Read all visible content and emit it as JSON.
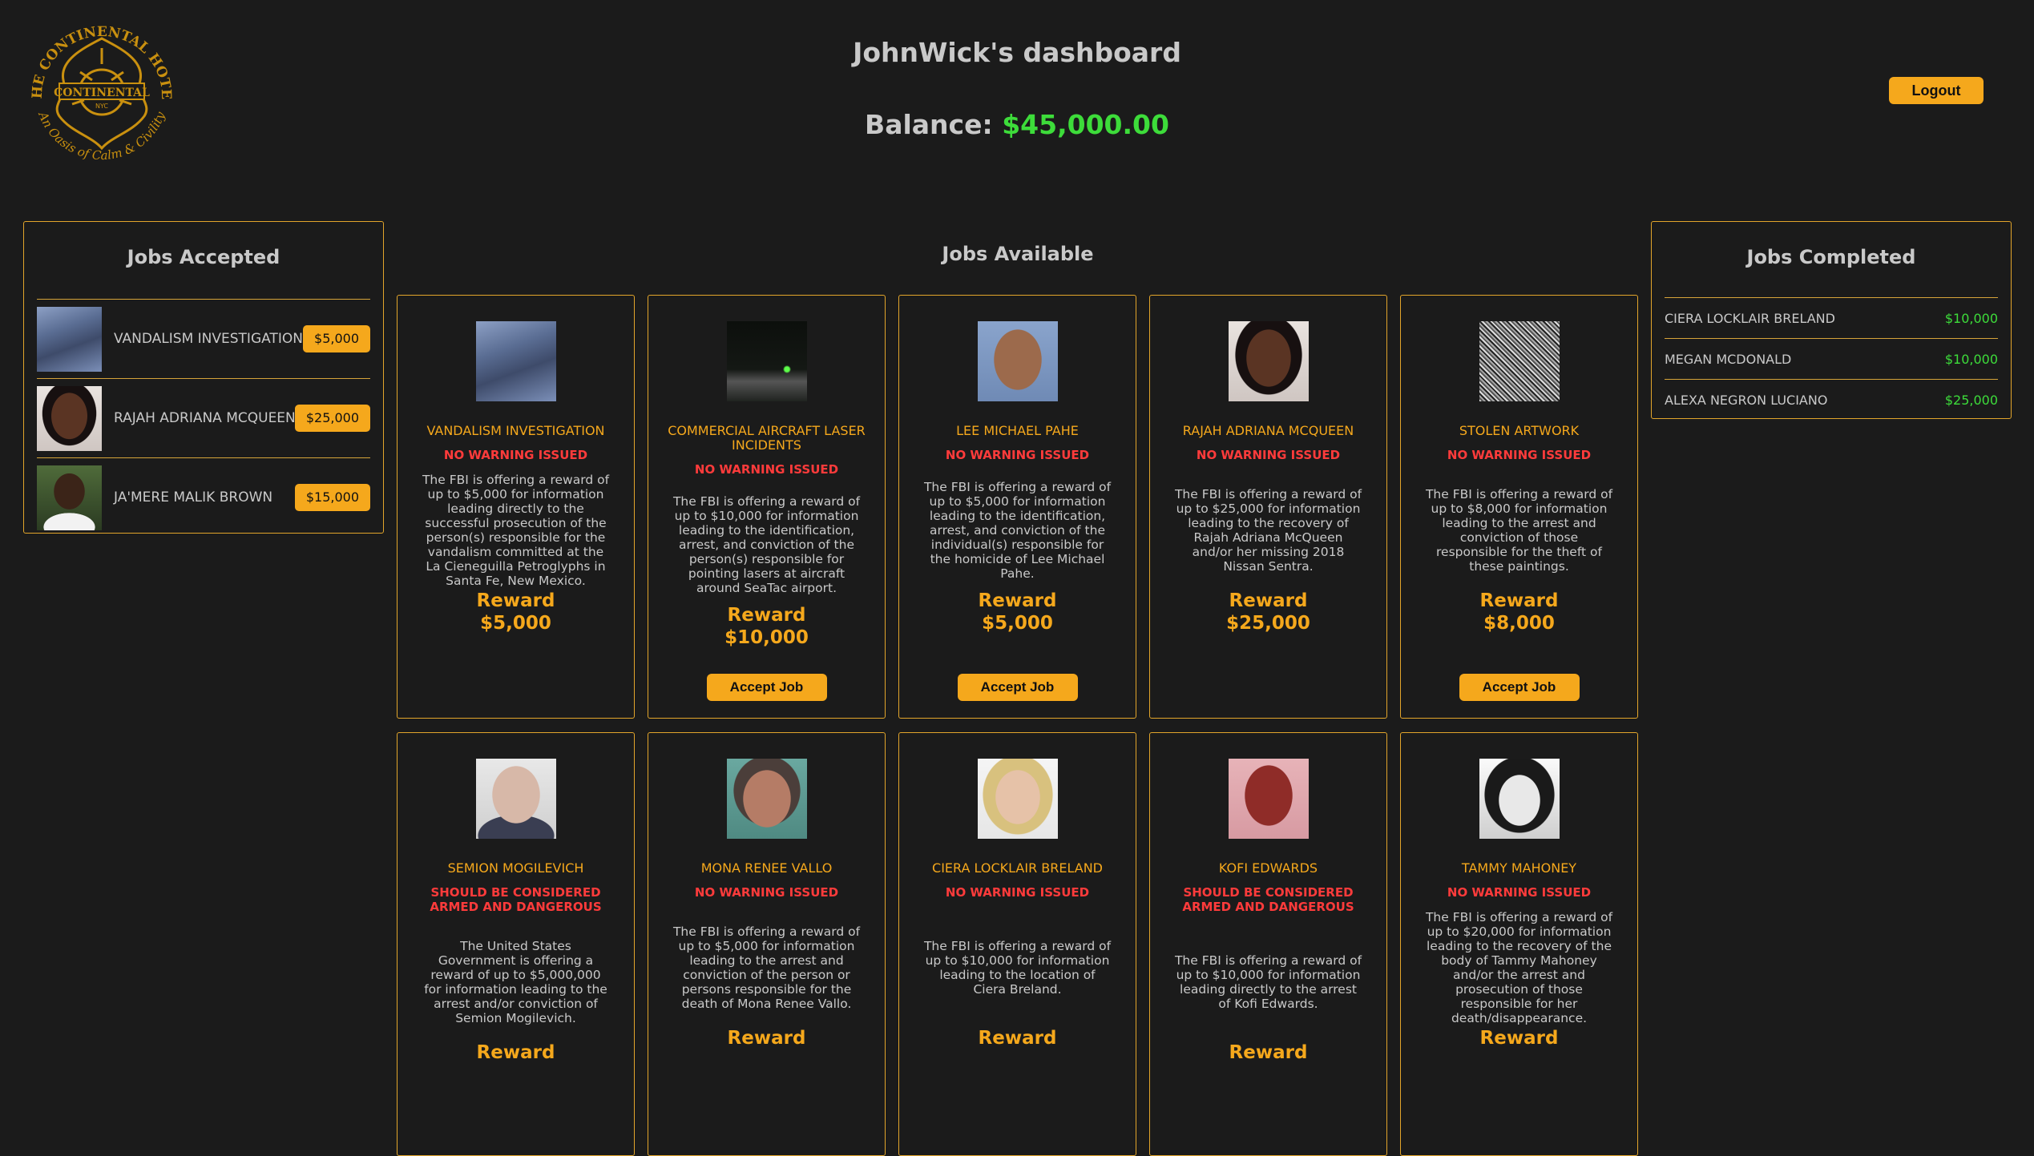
{
  "header": {
    "logo_alt": "The Continental Hotel - An Oasis of Calm & Civility",
    "title": "JohnWick's dashboard",
    "balance_label": "Balance:",
    "balance_value": "$45,000.00",
    "logout_label": "Logout"
  },
  "accepted": {
    "title": "Jobs Accepted",
    "items": [
      {
        "name": "VANDALISM INVESTIGATION",
        "reward": "$5,000",
        "thumb": "rock"
      },
      {
        "name": "RAJAH ADRIANA MCQUEEN",
        "reward": "$25,000",
        "thumb": "woman"
      },
      {
        "name": "JA'MERE MALIK BROWN",
        "reward": "$15,000",
        "thumb": "man-outdoor"
      }
    ]
  },
  "completed": {
    "title": "Jobs Completed",
    "items": [
      {
        "name": "CIERA LOCKLAIR BRELAND",
        "amount": "$10,000"
      },
      {
        "name": "MEGAN MCDONALD",
        "amount": "$10,000"
      },
      {
        "name": "ALEXA NEGRON LUCIANO",
        "amount": "$25,000"
      }
    ]
  },
  "available": {
    "title": "Jobs Available",
    "reward_label": "Reward",
    "accept_label": "Accept Job",
    "cards": [
      {
        "thumb": "rock",
        "title": "VANDALISM INVESTIGATION",
        "warning": "NO WARNING ISSUED",
        "desc": "The FBI is offering a reward of up to $5,000 for information leading directly to the successful prosecution of the person(s) responsible for the vandalism committed at the La Cieneguilla Petroglyphs in Santa Fe, New Mexico.",
        "reward": "$5,000",
        "show_accept": false
      },
      {
        "thumb": "night",
        "title": "COMMERCIAL AIRCRAFT LASER INCIDENTS",
        "warning": "NO WARNING ISSUED",
        "desc": "The FBI is offering a reward of up to $10,000 for information leading to the identification, arrest, and conviction of the person(s) responsible for pointing lasers at aircraft around SeaTac airport.",
        "reward": "$10,000",
        "show_accept": true
      },
      {
        "thumb": "mugshot",
        "title": "LEE MICHAEL PAHE",
        "warning": "NO WARNING ISSUED",
        "desc": "The FBI is offering a reward of up to $5,000 for information leading to the identification, arrest, and conviction of the individual(s) responsible for the homicide of Lee Michael Pahe.",
        "reward": "$5,000",
        "show_accept": true
      },
      {
        "thumb": "woman",
        "title": "RAJAH ADRIANA MCQUEEN",
        "warning": "NO WARNING ISSUED",
        "desc": "The FBI is offering a reward of up to $25,000 for information leading to the recovery of Rajah Adriana McQueen and/or her missing 2018 Nissan Sentra.",
        "reward": "$25,000",
        "show_accept": false
      },
      {
        "thumb": "noise",
        "title": "STOLEN ARTWORK",
        "warning": "NO WARNING ISSUED",
        "desc": "The FBI is offering a reward of up to $8,000 for information leading to the arrest and conviction of those responsible for the theft of these paintings.",
        "reward": "$8,000",
        "show_accept": true
      },
      {
        "thumb": "oldman",
        "title": "SEMION MOGILEVICH",
        "warning": "SHOULD BE CONSIDERED ARMED AND DANGEROUS",
        "desc": "The United States Government is offering a reward of up to $5,000,000 for information leading to the arrest and/or conviction of Semion Mogilevich.",
        "reward": "",
        "show_accept": false
      },
      {
        "thumb": "woman2",
        "title": "MONA RENEE VALLO",
        "warning": "NO WARNING ISSUED",
        "desc": "The FBI is offering a reward of up to $5,000 for information leading to the arrest and conviction of the person or persons responsible for the death of Mona Renee Vallo.",
        "reward": "",
        "show_accept": false
      },
      {
        "thumb": "blonde",
        "title": "CIERA LOCKLAIR BRELAND",
        "warning": "NO WARNING ISSUED",
        "desc": "The FBI is offering a reward of up to $10,000 for information leading to the location of Ciera Breland.",
        "reward": "",
        "show_accept": false
      },
      {
        "thumb": "redman",
        "title": "KOFI EDWARDS",
        "warning": "SHOULD BE CONSIDERED ARMED AND DANGEROUS",
        "desc": "The FBI is offering a reward of up to $10,000 for information leading directly to the arrest of Kofi Edwards.",
        "reward": "",
        "show_accept": false
      },
      {
        "thumb": "bw-woman",
        "title": "TAMMY MAHONEY",
        "warning": "NO WARNING ISSUED",
        "desc": "The FBI is offering a reward of up to $20,000 for information leading to the recovery of the body of Tammy Mahoney and/or the arrest and prosecution of those responsible for her death/disappearance.",
        "reward": "",
        "show_accept": false
      }
    ]
  },
  "colors": {
    "background": "#1b1b1b",
    "accent": "#f5a81c",
    "border": "#e2a52b",
    "warning": "#ff3b3b",
    "money_green": "#3ddc3a"
  }
}
